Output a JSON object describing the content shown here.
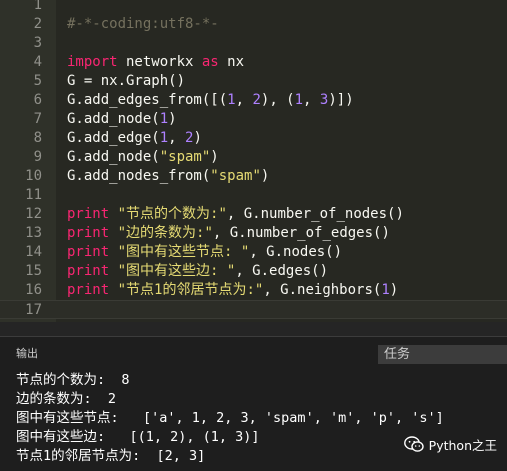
{
  "editor": {
    "lines": [
      {
        "n": "1",
        "tokens": []
      },
      {
        "n": "2",
        "tokens": [
          {
            "t": "#-*-coding:utf8-*-",
            "c": "cm"
          }
        ]
      },
      {
        "n": "3",
        "tokens": []
      },
      {
        "n": "4",
        "tokens": [
          {
            "t": "import",
            "c": "kw"
          },
          {
            "t": " networkx ",
            "c": "pl"
          },
          {
            "t": "as",
            "c": "kw"
          },
          {
            "t": " nx",
            "c": "pl"
          }
        ]
      },
      {
        "n": "5",
        "tokens": [
          {
            "t": "G = nx.Graph()",
            "c": "pl"
          }
        ]
      },
      {
        "n": "6",
        "tokens": [
          {
            "t": "G.add_edges_from([(",
            "c": "pl"
          },
          {
            "t": "1",
            "c": "num"
          },
          {
            "t": ", ",
            "c": "pl"
          },
          {
            "t": "2",
            "c": "num"
          },
          {
            "t": "), (",
            "c": "pl"
          },
          {
            "t": "1",
            "c": "num"
          },
          {
            "t": ", ",
            "c": "pl"
          },
          {
            "t": "3",
            "c": "num"
          },
          {
            "t": ")])",
            "c": "pl"
          }
        ]
      },
      {
        "n": "7",
        "tokens": [
          {
            "t": "G.add_node(",
            "c": "pl"
          },
          {
            "t": "1",
            "c": "num"
          },
          {
            "t": ")",
            "c": "pl"
          }
        ]
      },
      {
        "n": "8",
        "tokens": [
          {
            "t": "G.add_edge(",
            "c": "pl"
          },
          {
            "t": "1",
            "c": "num"
          },
          {
            "t": ", ",
            "c": "pl"
          },
          {
            "t": "2",
            "c": "num"
          },
          {
            "t": ")",
            "c": "pl"
          }
        ]
      },
      {
        "n": "9",
        "tokens": [
          {
            "t": "G.add_node(",
            "c": "pl"
          },
          {
            "t": "\"spam\"",
            "c": "str"
          },
          {
            "t": ")",
            "c": "pl"
          }
        ]
      },
      {
        "n": "10",
        "tokens": [
          {
            "t": "G.add_nodes_from(",
            "c": "pl"
          },
          {
            "t": "\"spam\"",
            "c": "str"
          },
          {
            "t": ")",
            "c": "pl"
          }
        ]
      },
      {
        "n": "11",
        "tokens": []
      },
      {
        "n": "12",
        "tokens": [
          {
            "t": "print",
            "c": "kw"
          },
          {
            "t": " ",
            "c": "pl"
          },
          {
            "t": "\"节点的个数为:\"",
            "c": "str"
          },
          {
            "t": ", G.number_of_nodes()",
            "c": "pl"
          }
        ]
      },
      {
        "n": "13",
        "tokens": [
          {
            "t": "print",
            "c": "kw"
          },
          {
            "t": " ",
            "c": "pl"
          },
          {
            "t": "\"边的条数为:\"",
            "c": "str"
          },
          {
            "t": ", G.number_of_edges()",
            "c": "pl"
          }
        ]
      },
      {
        "n": "14",
        "tokens": [
          {
            "t": "print",
            "c": "kw"
          },
          {
            "t": " ",
            "c": "pl"
          },
          {
            "t": "\"图中有这些节点: \"",
            "c": "str"
          },
          {
            "t": ", G.nodes()",
            "c": "pl"
          }
        ]
      },
      {
        "n": "15",
        "tokens": [
          {
            "t": "print",
            "c": "kw"
          },
          {
            "t": " ",
            "c": "pl"
          },
          {
            "t": "\"图中有这些边: \"",
            "c": "str"
          },
          {
            "t": ", G.edges()",
            "c": "pl"
          }
        ]
      },
      {
        "n": "16",
        "tokens": [
          {
            "t": "print",
            "c": "kw"
          },
          {
            "t": " ",
            "c": "pl"
          },
          {
            "t": "\"节点1的邻居节点为:\"",
            "c": "str"
          },
          {
            "t": ", G.neighbors(",
            "c": "pl"
          },
          {
            "t": "1",
            "c": "num"
          },
          {
            "t": ")",
            "c": "pl"
          }
        ]
      },
      {
        "n": "17",
        "tokens": []
      }
    ],
    "current_line": "17"
  },
  "panel": {
    "title": "输出",
    "task_tab": "任务",
    "output_lines": [
      "节点的个数为:  8",
      "边的条数为:  2",
      "图中有这些节点:   ['a', 1, 2, 3, 'spam', 'm', 'p', 's']",
      "图中有这些边:   [(1, 2), (1, 3)]",
      "节点1的邻居节点为:  [2, 3]"
    ]
  },
  "watermark": {
    "text": "Python之王",
    "icon": "wechat-icon"
  }
}
